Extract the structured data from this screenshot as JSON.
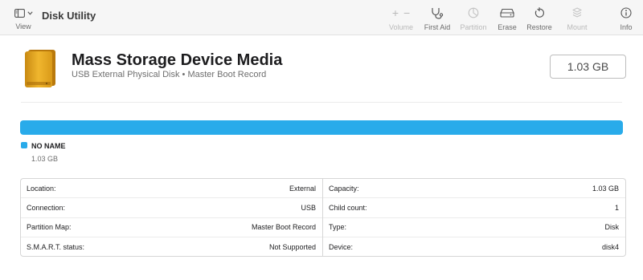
{
  "app": {
    "title": "Disk Utility"
  },
  "toolbar": {
    "view_label": "View",
    "volume_label": "Volume",
    "first_aid_label": "First Aid",
    "partition_label": "Partition",
    "erase_label": "Erase",
    "restore_label": "Restore",
    "mount_label": "Mount",
    "info_label": "Info",
    "disabled": [
      "Volume",
      "Partition",
      "Mount"
    ]
  },
  "device": {
    "name": "Mass Storage Device Media",
    "subtitle": "USB External Physical Disk • Master Boot Record",
    "size": "1.03 GB",
    "icon": "external-drive-icon"
  },
  "usage": {
    "color": "#29abea",
    "partitions": [
      {
        "name": "NO NAME",
        "size": "1.03 GB",
        "fraction": 1.0
      }
    ]
  },
  "info": {
    "left": [
      {
        "label": "Location:",
        "value": "External"
      },
      {
        "label": "Connection:",
        "value": "USB"
      },
      {
        "label": "Partition Map:",
        "value": "Master Boot Record"
      },
      {
        "label": "S.M.A.R.T. status:",
        "value": "Not Supported"
      }
    ],
    "right": [
      {
        "label": "Capacity:",
        "value": "1.03 GB"
      },
      {
        "label": "Child count:",
        "value": "1"
      },
      {
        "label": "Type:",
        "value": "Disk"
      },
      {
        "label": "Device:",
        "value": "disk4"
      }
    ]
  }
}
